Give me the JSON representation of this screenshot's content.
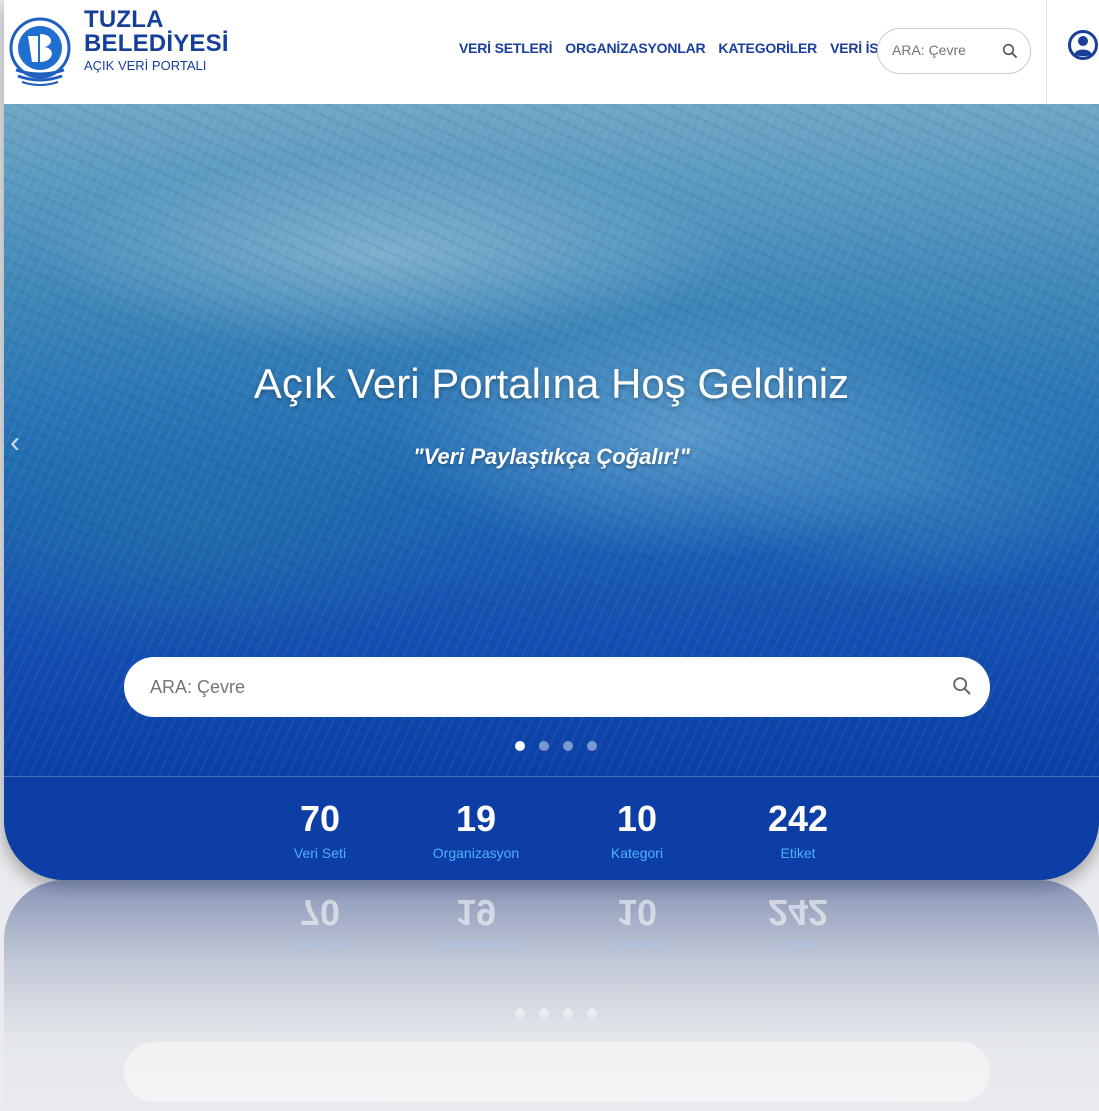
{
  "brand": {
    "line1": "TUZLA",
    "line2": "BELEDİYESİ",
    "line3": "AÇIK VERİ PORTALI"
  },
  "nav": {
    "items": [
      {
        "label": "VERİ SETLERİ"
      },
      {
        "label": "ORGANİZASYONLAR"
      },
      {
        "label": "KATEGORİLER"
      },
      {
        "label": "VERİ İSTEKLERİ"
      }
    ]
  },
  "header_search": {
    "placeholder": "ARA: Çevre",
    "icon": "search-icon"
  },
  "user": {
    "icon": "user-circle-icon"
  },
  "hero": {
    "title": "Açık Veri Portalına Hoş Geldiniz",
    "subtitle": "\"Veri Paylaştıkça Çoğalır!\"",
    "prev_glyph": "‹",
    "search_placeholder": "ARA: Çevre",
    "slides": {
      "count": 4,
      "active": 1
    }
  },
  "stats": [
    {
      "value": "70",
      "label": "Veri Seti"
    },
    {
      "value": "19",
      "label": "Organizasyon"
    },
    {
      "value": "10",
      "label": "Kategori"
    },
    {
      "value": "242",
      "label": "Etiket"
    }
  ],
  "colors": {
    "brand": "#163f9a",
    "accent": "#4fb0ff",
    "stats_bg": "#0c3ea5"
  }
}
